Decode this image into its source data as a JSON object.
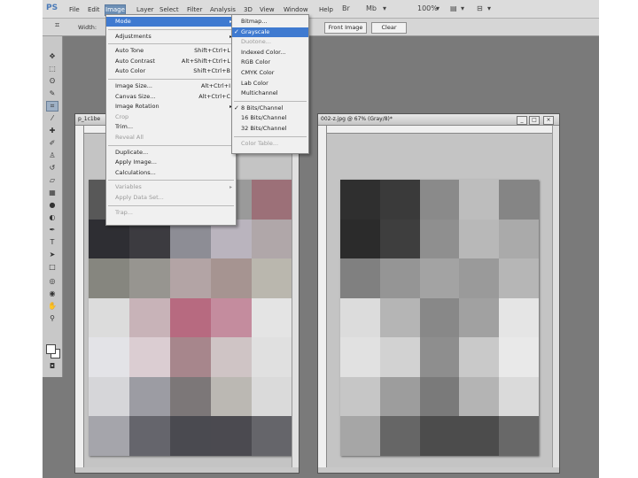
{
  "app": {
    "logo": "PS",
    "menus": [
      "File",
      "Edit",
      "Image",
      "Layer",
      "Select",
      "Filter",
      "Analysis",
      "3D",
      "View",
      "Window",
      "Help"
    ],
    "active_menu": "Image",
    "menubar_icons": [
      "Br",
      "Mb",
      "▾",
      "100%",
      "▾",
      "▤",
      "▾",
      "⊟",
      "▾"
    ]
  },
  "options": {
    "tool_icon": "⌗",
    "width_label": "Width:",
    "front_image": "Front Image",
    "clear": "Clear"
  },
  "image_menu": {
    "items": [
      {
        "label": "Mode",
        "arrow": "▸",
        "highlight": true
      },
      {
        "sep": true
      },
      {
        "label": "Adjustments",
        "arrow": "▸"
      },
      {
        "sep": true
      },
      {
        "label": "Auto Tone",
        "shortcut": "Shift+Ctrl+L"
      },
      {
        "label": "Auto Contrast",
        "shortcut": "Alt+Shift+Ctrl+L"
      },
      {
        "label": "Auto Color",
        "shortcut": "Shift+Ctrl+B"
      },
      {
        "sep": true
      },
      {
        "label": "Image Size...",
        "shortcut": "Alt+Ctrl+I"
      },
      {
        "label": "Canvas Size...",
        "shortcut": "Alt+Ctrl+C"
      },
      {
        "label": "Image Rotation",
        "arrow": "▸"
      },
      {
        "label": "Crop",
        "disabled": true
      },
      {
        "label": "Trim..."
      },
      {
        "label": "Reveal All",
        "disabled": true
      },
      {
        "sep": true
      },
      {
        "label": "Duplicate..."
      },
      {
        "label": "Apply Image..."
      },
      {
        "label": "Calculations..."
      },
      {
        "sep": true
      },
      {
        "label": "Variables",
        "arrow": "▸",
        "disabled": true
      },
      {
        "label": "Apply Data Set...",
        "disabled": true
      },
      {
        "sep": true
      },
      {
        "label": "Trap...",
        "disabled": true
      }
    ]
  },
  "mode_menu": {
    "items": [
      {
        "label": "Bitmap..."
      },
      {
        "label": "Grayscale",
        "checked": true,
        "highlight": true
      },
      {
        "label": "Duotone...",
        "disabled": true
      },
      {
        "label": "Indexed Color..."
      },
      {
        "label": "RGB Color"
      },
      {
        "label": "CMYK Color"
      },
      {
        "label": "Lab Color"
      },
      {
        "label": "Multichannel"
      },
      {
        "sep": true
      },
      {
        "label": "8 Bits/Channel",
        "checked": true
      },
      {
        "label": "16 Bits/Channel"
      },
      {
        "label": "32 Bits/Channel"
      },
      {
        "sep": true
      },
      {
        "label": "Color Table...",
        "disabled": true
      }
    ]
  },
  "doc_left": {
    "title": "p_1c1be",
    "cells": [
      "#585858",
      "#6a6a6a",
      "#808080",
      "#9a9a9a",
      "#9c7078",
      "#2e2e33",
      "#3c3b40",
      "#8d8d95",
      "#bab4be",
      "#b0a7a9",
      "#86867f",
      "#979590",
      "#b3a4a5",
      "#a69491",
      "#bab7ae",
      "#dcdcdc",
      "#c8b3b8",
      "#b76a80",
      "#c48c9e",
      "#e4e4e4",
      "#e3e3e7",
      "#dbcdd2",
      "#a7868c",
      "#cfc4c5",
      "#e0e0e0",
      "#d6d6d9",
      "#9c9ca3",
      "#7c7778",
      "#bbb8b3",
      "#dadada",
      "#a5a5ab",
      "#65656c",
      "#4a4a50",
      "#4b4a50",
      "#65656a"
    ]
  },
  "doc_right": {
    "title": "002-z.jpg @ 67% (Gray/8)*",
    "controls": [
      "_",
      "□",
      "×"
    ],
    "cells": [
      "#2f2f2f",
      "#3a3a3a",
      "#8a8a8a",
      "#bdbdbd",
      "#858585",
      "#2b2b2b",
      "#3e3e3e",
      "#8f8f8f",
      "#b8b8b8",
      "#aaaaaa",
      "#808080",
      "#959595",
      "#a3a3a3",
      "#9a9a9a",
      "#b6b6b6",
      "#dcdcdc",
      "#b5b5b5",
      "#888888",
      "#a1a1a1",
      "#e5e5e5",
      "#e1e1e1",
      "#d2d2d2",
      "#8e8e8e",
      "#c9c9c9",
      "#e9e9e9",
      "#c6c6c6",
      "#9d9d9d",
      "#7a7a7a",
      "#b4b4b4",
      "#dadada",
      "#a6a6a6",
      "#666666",
      "#4c4c4c",
      "#4c4c4c",
      "#686868"
    ]
  }
}
